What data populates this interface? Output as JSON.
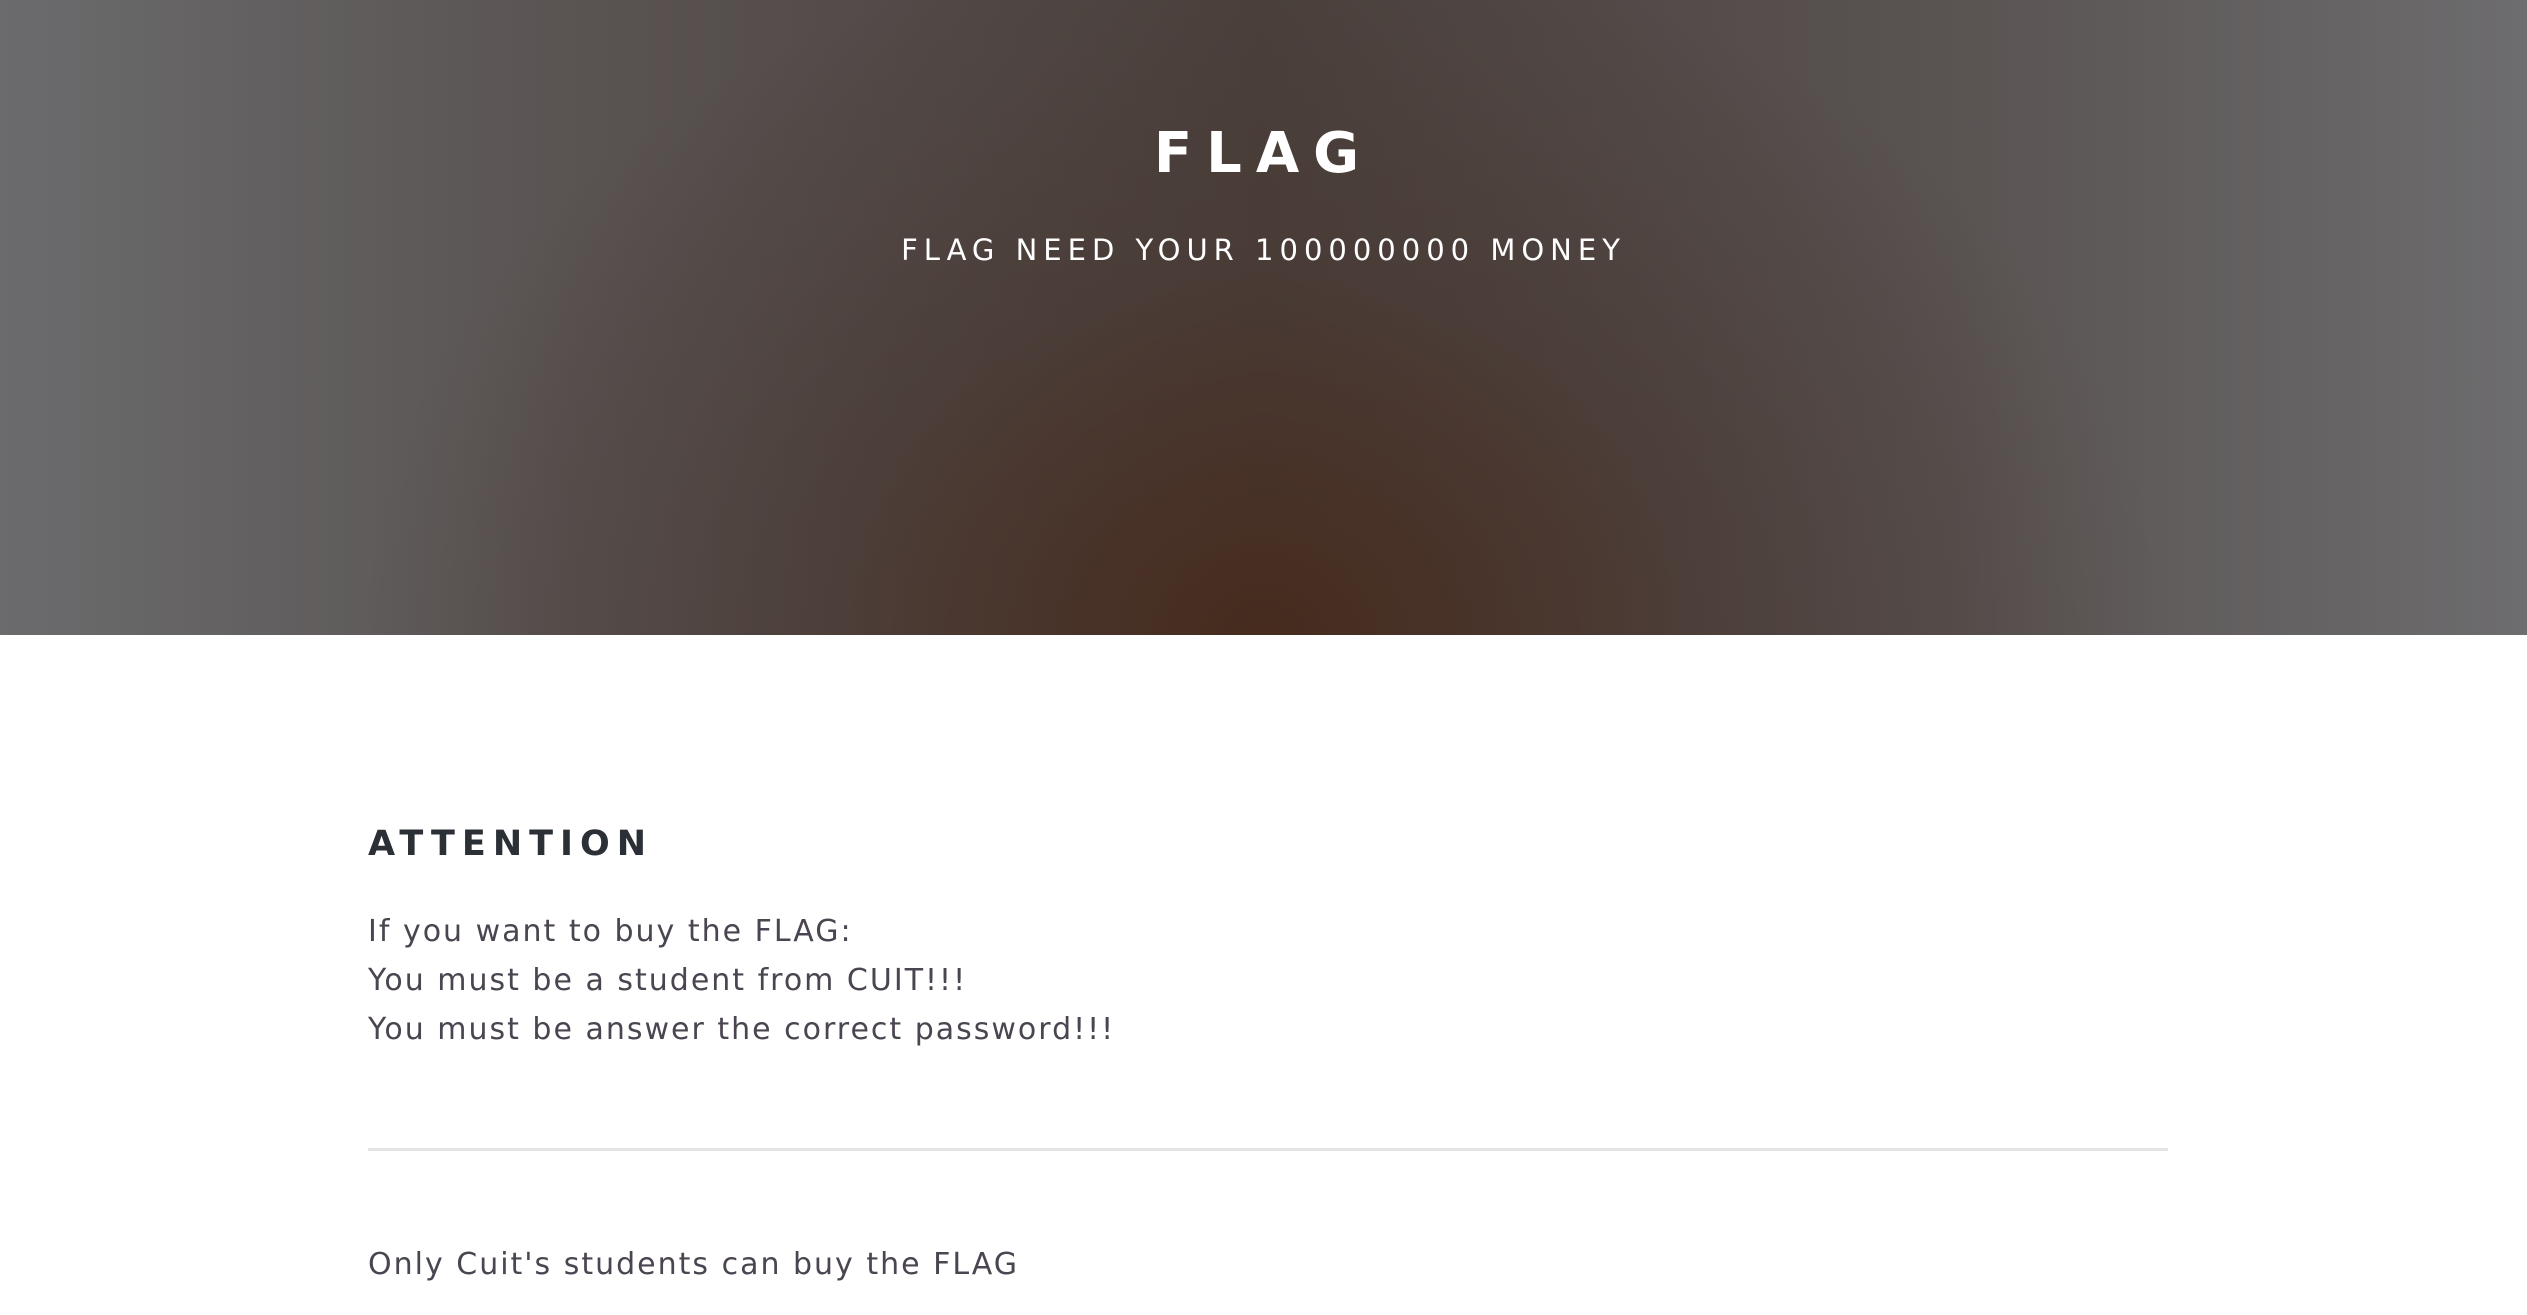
{
  "hero": {
    "title": "FLAG",
    "subtitle": "FLAG NEED YOUR 100000000 MONEY"
  },
  "attention": {
    "heading": "ATTENTION",
    "lines": [
      "If you want to buy the FLAG:",
      "You must be a student from CUIT!!!",
      "You must be answer the correct password!!!"
    ]
  },
  "note": "Only Cuit's students can buy the FLAG"
}
